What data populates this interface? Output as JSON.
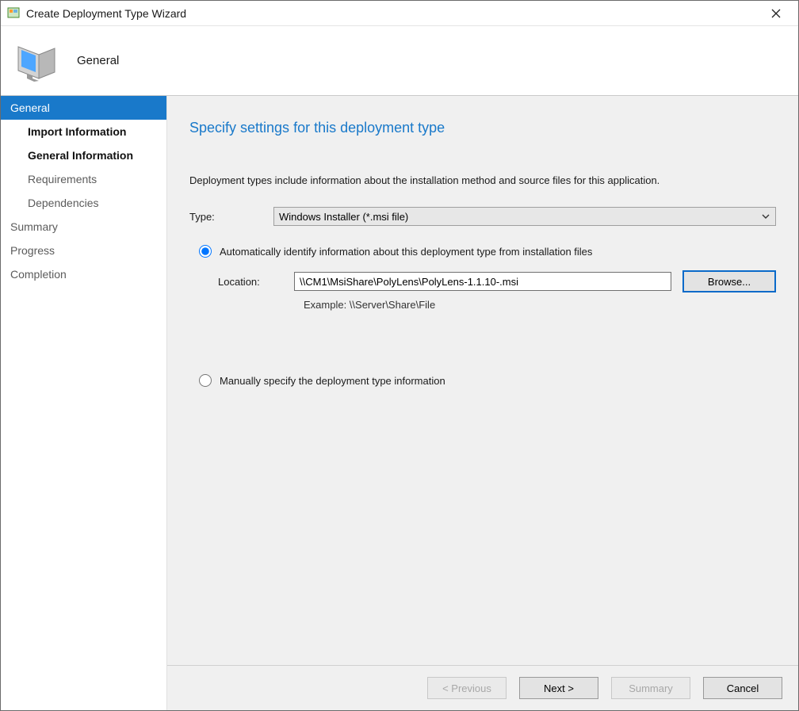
{
  "window": {
    "title": "Create Deployment Type Wizard"
  },
  "header": {
    "title": "General"
  },
  "sidebar": {
    "items": [
      {
        "label": "General",
        "active": true,
        "sub": false,
        "bold": false,
        "dim": false
      },
      {
        "label": "Import Information",
        "active": false,
        "sub": true,
        "bold": true,
        "dim": false
      },
      {
        "label": "General Information",
        "active": false,
        "sub": true,
        "bold": true,
        "dim": false
      },
      {
        "label": "Requirements",
        "active": false,
        "sub": true,
        "bold": false,
        "dim": true
      },
      {
        "label": "Dependencies",
        "active": false,
        "sub": true,
        "bold": false,
        "dim": true
      },
      {
        "label": "Summary",
        "active": false,
        "sub": false,
        "bold": false,
        "dim": true
      },
      {
        "label": "Progress",
        "active": false,
        "sub": false,
        "bold": false,
        "dim": true
      },
      {
        "label": "Completion",
        "active": false,
        "sub": false,
        "bold": false,
        "dim": true
      }
    ]
  },
  "content": {
    "heading": "Specify settings for this deployment type",
    "description": "Deployment types include information about the installation method and source files for this application.",
    "type_label": "Type:",
    "type_value": "Windows Installer (*.msi file)",
    "radio_auto": "Automatically identify information about this deployment type from installation files",
    "location_label": "Location:",
    "location_value": "\\\\CM1\\MsiShare\\PolyLens\\PolyLens-1.1.10-.msi",
    "example_label": "Example: \\\\Server\\Share\\File",
    "browse_btn": "Browse...",
    "radio_manual": "Manually specify the deployment type information",
    "selected_mode": "auto"
  },
  "footer": {
    "previous": "< Previous",
    "next": "Next >",
    "summary": "Summary",
    "cancel": "Cancel"
  }
}
